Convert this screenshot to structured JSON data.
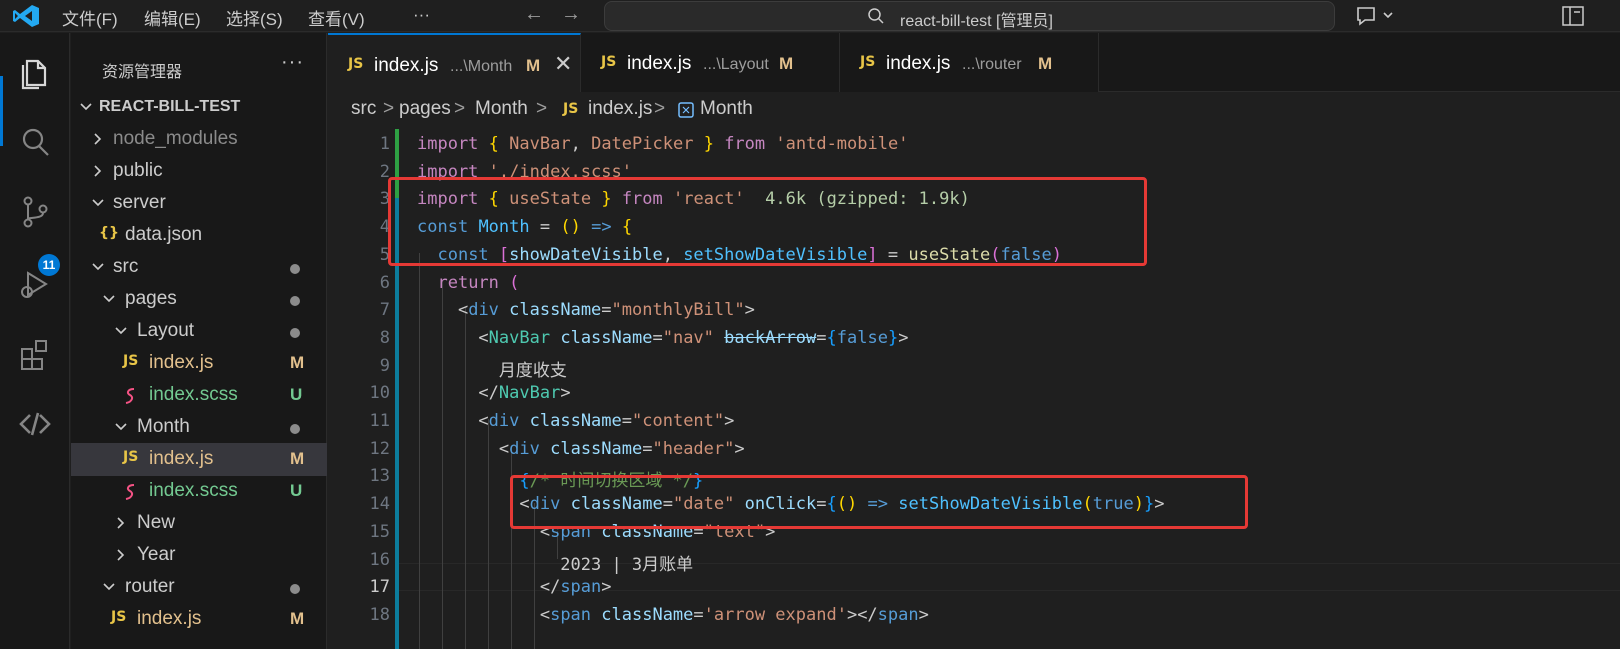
{
  "titlebar": {
    "menus": [
      "文件(F)",
      "编辑(E)",
      "选择(S)",
      "查看(V)",
      "···"
    ],
    "search_label": "react-bill-test [管理员]"
  },
  "activity": {
    "scm_badge": "11"
  },
  "sidebar": {
    "title": "资源管理器",
    "more": "···",
    "tree": [
      {
        "name": "REACT-BILL-TEST",
        "status": ""
      },
      {
        "name": "node_modules",
        "status": ""
      },
      {
        "name": "public",
        "status": ""
      },
      {
        "name": "server",
        "status": ""
      },
      {
        "name": "data.json",
        "status": "",
        "icon": "{}"
      },
      {
        "name": "src",
        "status": ""
      },
      {
        "name": "pages",
        "status": ""
      },
      {
        "name": "Layout",
        "status": ""
      },
      {
        "name": "index.js",
        "status": "M",
        "icon": "JS"
      },
      {
        "name": "index.scss",
        "status": "U"
      },
      {
        "name": "Month",
        "status": ""
      },
      {
        "name": "index.js",
        "status": "M",
        "icon": "JS"
      },
      {
        "name": "index.scss",
        "status": "U"
      },
      {
        "name": "New",
        "status": ""
      },
      {
        "name": "Year",
        "status": ""
      },
      {
        "name": "router",
        "status": ""
      },
      {
        "name": "index.js",
        "status": "M",
        "icon": "JS"
      }
    ]
  },
  "tabs": [
    {
      "icon": "JS",
      "name": "index.js",
      "path": "...\\Month",
      "mod": "M",
      "close": "✕"
    },
    {
      "icon": "JS",
      "name": "index.js",
      "path": "...\\Layout",
      "mod": "M"
    },
    {
      "icon": "JS",
      "name": "index.js",
      "path": "...\\router",
      "mod": "M"
    }
  ],
  "breadcrumb": [
    "src",
    ">",
    "pages",
    ">",
    "Month",
    ">",
    "JS",
    "index.js",
    ">",
    "Month"
  ],
  "editor": {
    "line_numbers": [
      "1",
      "2",
      "3",
      "4",
      "5",
      "6",
      "7",
      "8",
      "9",
      "10",
      "11",
      "12",
      "13",
      "14",
      "15",
      "16",
      "17",
      "18"
    ],
    "current_line": "17",
    "lines": [
      [
        [
          "k",
          "import"
        ],
        [
          "p",
          " "
        ],
        [
          "b1",
          "{"
        ],
        [
          "p",
          " "
        ],
        [
          "s",
          "NavBar"
        ],
        [
          "p",
          ", "
        ],
        [
          "s",
          "DatePicker"
        ],
        [
          "p",
          " "
        ],
        [
          "b1",
          "}"
        ],
        [
          "p",
          " "
        ],
        [
          "k",
          "from"
        ],
        [
          "p",
          " "
        ],
        [
          "s",
          "'antd-mobile'"
        ]
      ],
      [
        [
          "k",
          "import"
        ],
        [
          "p",
          " "
        ],
        [
          "s",
          "'./index.scss'"
        ]
      ],
      [
        [
          "k",
          "import"
        ],
        [
          "p",
          " "
        ],
        [
          "b1",
          "{"
        ],
        [
          "p",
          " "
        ],
        [
          "s",
          "useState"
        ],
        [
          "p",
          " "
        ],
        [
          "b1",
          "}"
        ],
        [
          "p",
          " "
        ],
        [
          "k",
          "from"
        ],
        [
          "p",
          " "
        ],
        [
          "s",
          "'react'"
        ],
        [
          "p",
          "  "
        ],
        [
          "hint",
          "4.6k (gzipped: 1.9k)"
        ]
      ],
      [
        [
          "kb",
          "const"
        ],
        [
          "p",
          " "
        ],
        [
          "fn",
          "Month"
        ],
        [
          "p",
          " = "
        ],
        [
          "b1",
          "("
        ],
        [
          "b1",
          ")"
        ],
        [
          "p",
          " "
        ],
        [
          "kb",
          "=>"
        ],
        [
          "p",
          " "
        ],
        [
          "b1",
          "{"
        ]
      ],
      [
        [
          "p",
          "  "
        ],
        [
          "kb",
          "const"
        ],
        [
          "p",
          " "
        ],
        [
          "b2",
          "["
        ],
        [
          "v",
          "showDateVisible"
        ],
        [
          "p",
          ", "
        ],
        [
          "fn",
          "setShowDateVisible"
        ],
        [
          "b2",
          "]"
        ],
        [
          "p",
          " = "
        ],
        [
          "f",
          "useState"
        ],
        [
          "b2",
          "("
        ],
        [
          "kb",
          "false"
        ],
        [
          "b2",
          ")"
        ]
      ],
      [
        [
          "p",
          "  "
        ],
        [
          "k",
          "return"
        ],
        [
          "p",
          " "
        ],
        [
          "b2",
          "("
        ]
      ],
      [
        [
          "p",
          "    "
        ],
        [
          "p",
          "<"
        ],
        [
          "t",
          "div"
        ],
        [
          "p",
          " "
        ],
        [
          "a",
          "className"
        ],
        [
          "p",
          "="
        ],
        [
          "s",
          "\"monthlyBill\""
        ],
        [
          "p",
          ">"
        ]
      ],
      [
        [
          "p",
          "      "
        ],
        [
          "p",
          "<"
        ],
        [
          "tc",
          "NavBar"
        ],
        [
          "p",
          " "
        ],
        [
          "a",
          "className"
        ],
        [
          "p",
          "="
        ],
        [
          "s",
          "\"nav\""
        ],
        [
          "p",
          " "
        ],
        [
          "a del",
          "backArrow"
        ],
        [
          "p",
          "="
        ],
        [
          "b3",
          "{"
        ],
        [
          "kb",
          "false"
        ],
        [
          "b3",
          "}"
        ],
        [
          "p",
          ">"
        ]
      ],
      [
        [
          "p",
          "        月度收支"
        ]
      ],
      [
        [
          "p",
          "      "
        ],
        [
          "p",
          "</"
        ],
        [
          "tc",
          "NavBar"
        ],
        [
          "p",
          ">"
        ]
      ],
      [
        [
          "p",
          "      "
        ],
        [
          "p",
          "<"
        ],
        [
          "t",
          "div"
        ],
        [
          "p",
          " "
        ],
        [
          "a",
          "className"
        ],
        [
          "p",
          "="
        ],
        [
          "s",
          "\"content\""
        ],
        [
          "p",
          ">"
        ]
      ],
      [
        [
          "p",
          "        "
        ],
        [
          "p",
          "<"
        ],
        [
          "t",
          "div"
        ],
        [
          "p",
          " "
        ],
        [
          "a",
          "className"
        ],
        [
          "p",
          "="
        ],
        [
          "s",
          "\"header\""
        ],
        [
          "p",
          ">"
        ]
      ],
      [
        [
          "p",
          "          "
        ],
        [
          "b3",
          "{"
        ],
        [
          "cm",
          "/* 时间切换区域 */"
        ],
        [
          "b3",
          "}"
        ]
      ],
      [
        [
          "p",
          "          "
        ],
        [
          "p",
          "<"
        ],
        [
          "t",
          "div"
        ],
        [
          "p",
          " "
        ],
        [
          "a",
          "className"
        ],
        [
          "p",
          "="
        ],
        [
          "s",
          "\"date\""
        ],
        [
          "p",
          " "
        ],
        [
          "a",
          "onClick"
        ],
        [
          "p",
          "="
        ],
        [
          "b3",
          "{"
        ],
        [
          "b1",
          "("
        ],
        [
          "b1",
          ")"
        ],
        [
          "p",
          " "
        ],
        [
          "kb",
          "=>"
        ],
        [
          "p",
          " "
        ],
        [
          "fn",
          "setShowDateVisible"
        ],
        [
          "b1",
          "("
        ],
        [
          "kb",
          "true"
        ],
        [
          "b1",
          ")"
        ],
        [
          "b3",
          "}"
        ],
        [
          "p",
          ">"
        ]
      ],
      [
        [
          "p",
          "            "
        ],
        [
          "p",
          "<"
        ],
        [
          "t",
          "span"
        ],
        [
          "p",
          " "
        ],
        [
          "a",
          "className"
        ],
        [
          "p",
          "="
        ],
        [
          "s",
          "\"text\""
        ],
        [
          "p",
          ">"
        ]
      ],
      [
        [
          "p",
          "              2023 | 3月账单"
        ]
      ],
      [
        [
          "p",
          "            "
        ],
        [
          "p",
          "</"
        ],
        [
          "t",
          "span"
        ],
        [
          "p",
          ">"
        ]
      ],
      [
        [
          "p",
          "            "
        ],
        [
          "p",
          "<"
        ],
        [
          "t",
          "span"
        ],
        [
          "p",
          " "
        ],
        [
          "a",
          "className"
        ],
        [
          "p",
          "="
        ],
        [
          "s",
          "'arrow expand'"
        ],
        [
          "p",
          "></"
        ],
        [
          "t",
          "span"
        ],
        [
          "p",
          ">"
        ]
      ]
    ]
  },
  "colors": {
    "accent": "#0078d4",
    "git_added": "#2ea043",
    "git_modified": "#0c7d9d",
    "annotation_red": "#e53935",
    "js_icon": "#e8c547",
    "modified": "#e2c08d",
    "untracked": "#73c991"
  }
}
